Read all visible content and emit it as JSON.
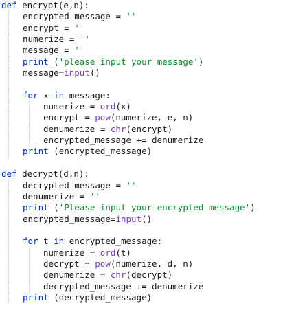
{
  "editor": {
    "colors": {
      "background": "#ffffff",
      "text": "#1a1a1a",
      "keyword": "#0033b3",
      "builtin": "#7a3db8",
      "string": "#0a8a2a"
    },
    "lines": [
      {
        "indent": 0,
        "tokens": [
          {
            "t": "def",
            "c": "kw"
          },
          {
            "t": " encrypt(e,n):",
            "c": "tx"
          }
        ]
      },
      {
        "indent": 1,
        "tokens": [
          {
            "t": "encrypted_message = ",
            "c": "tx"
          },
          {
            "t": "''",
            "c": "str"
          }
        ]
      },
      {
        "indent": 1,
        "tokens": [
          {
            "t": "encrypt = ",
            "c": "tx"
          },
          {
            "t": "''",
            "c": "str"
          }
        ]
      },
      {
        "indent": 1,
        "tokens": [
          {
            "t": "numerize = ",
            "c": "tx"
          },
          {
            "t": "''",
            "c": "str"
          }
        ]
      },
      {
        "indent": 1,
        "tokens": [
          {
            "t": "message = ",
            "c": "tx"
          },
          {
            "t": "''",
            "c": "str"
          }
        ]
      },
      {
        "indent": 1,
        "tokens": [
          {
            "t": "print",
            "c": "kw"
          },
          {
            "t": " (",
            "c": "tx"
          },
          {
            "t": "'please input your message'",
            "c": "str"
          },
          {
            "t": ")",
            "c": "tx"
          }
        ]
      },
      {
        "indent": 1,
        "tokens": [
          {
            "t": "message=",
            "c": "tx"
          },
          {
            "t": "input",
            "c": "fn"
          },
          {
            "t": "()",
            "c": "tx"
          }
        ]
      },
      {
        "indent": 1,
        "tokens": []
      },
      {
        "indent": 1,
        "tokens": [
          {
            "t": "for",
            "c": "kw"
          },
          {
            "t": " x ",
            "c": "tx"
          },
          {
            "t": "in",
            "c": "kw"
          },
          {
            "t": " message:",
            "c": "tx"
          }
        ]
      },
      {
        "indent": 2,
        "tokens": [
          {
            "t": "numerize = ",
            "c": "tx"
          },
          {
            "t": "ord",
            "c": "fn"
          },
          {
            "t": "(x)",
            "c": "tx"
          }
        ]
      },
      {
        "indent": 2,
        "tokens": [
          {
            "t": "encrypt = ",
            "c": "tx"
          },
          {
            "t": "pow",
            "c": "fn"
          },
          {
            "t": "(numerize, e, n)",
            "c": "tx"
          }
        ]
      },
      {
        "indent": 2,
        "tokens": [
          {
            "t": "denumerize = ",
            "c": "tx"
          },
          {
            "t": "chr",
            "c": "fn"
          },
          {
            "t": "(encrypt)",
            "c": "tx"
          }
        ]
      },
      {
        "indent": 2,
        "tokens": [
          {
            "t": "encrypted_message += denumerize",
            "c": "tx"
          }
        ]
      },
      {
        "indent": 1,
        "tokens": [
          {
            "t": "print",
            "c": "kw"
          },
          {
            "t": " (encrypted_message)",
            "c": "tx"
          }
        ]
      },
      {
        "indent": 0,
        "tokens": []
      },
      {
        "indent": 0,
        "tokens": [
          {
            "t": "def",
            "c": "kw"
          },
          {
            "t": " decrypt(d,n):",
            "c": "tx"
          }
        ]
      },
      {
        "indent": 1,
        "tokens": [
          {
            "t": "decrypted_message = ",
            "c": "tx"
          },
          {
            "t": "''",
            "c": "str"
          }
        ]
      },
      {
        "indent": 1,
        "tokens": [
          {
            "t": "denumerize = ",
            "c": "tx"
          },
          {
            "t": "''",
            "c": "str"
          }
        ]
      },
      {
        "indent": 1,
        "tokens": [
          {
            "t": "print",
            "c": "kw"
          },
          {
            "t": " (",
            "c": "tx"
          },
          {
            "t": "'Please input your encrypted message'",
            "c": "str"
          },
          {
            "t": ")",
            "c": "tx"
          }
        ]
      },
      {
        "indent": 1,
        "tokens": [
          {
            "t": "encrypted_message=",
            "c": "tx"
          },
          {
            "t": "input",
            "c": "fn"
          },
          {
            "t": "()",
            "c": "tx"
          }
        ]
      },
      {
        "indent": 1,
        "tokens": []
      },
      {
        "indent": 1,
        "tokens": [
          {
            "t": "for",
            "c": "kw"
          },
          {
            "t": " t ",
            "c": "tx"
          },
          {
            "t": "in",
            "c": "kw"
          },
          {
            "t": " encrypted_message:",
            "c": "tx"
          }
        ]
      },
      {
        "indent": 2,
        "tokens": [
          {
            "t": "numerize = ",
            "c": "tx"
          },
          {
            "t": "ord",
            "c": "fn"
          },
          {
            "t": "(t)",
            "c": "tx"
          }
        ]
      },
      {
        "indent": 2,
        "tokens": [
          {
            "t": "decrypt = ",
            "c": "tx"
          },
          {
            "t": "pow",
            "c": "fn"
          },
          {
            "t": "(numerize, d, n)",
            "c": "tx"
          }
        ]
      },
      {
        "indent": 2,
        "tokens": [
          {
            "t": "denumerize = ",
            "c": "tx"
          },
          {
            "t": "chr",
            "c": "fn"
          },
          {
            "t": "(decrypt)",
            "c": "tx"
          }
        ]
      },
      {
        "indent": 2,
        "tokens": [
          {
            "t": "decrypted_message += denumerize",
            "c": "tx"
          }
        ]
      },
      {
        "indent": 1,
        "tokens": [
          {
            "t": "print",
            "c": "kw"
          },
          {
            "t": " (decrypted_message)",
            "c": "tx"
          }
        ]
      }
    ]
  }
}
